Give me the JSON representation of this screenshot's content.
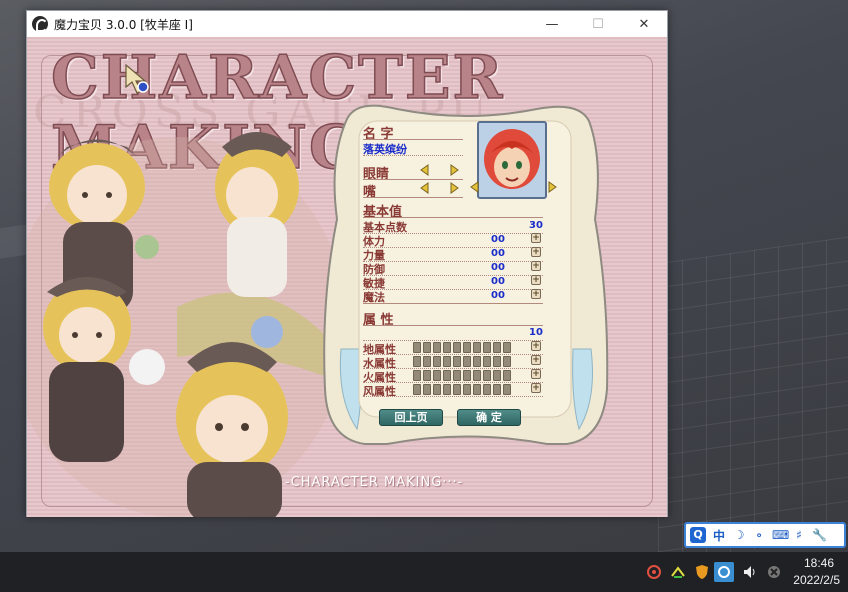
{
  "window": {
    "title": "魔力宝贝 3.0.0 [牧羊座 I]",
    "minimize_glyph": "—",
    "maximize_glyph": "☐",
    "close_glyph": "✕"
  },
  "game": {
    "banner_title": "CHARACTER MAKING",
    "watermark": "CROSS GATE PU",
    "bottom_caption": "-CHARACTER MAKING···-"
  },
  "character": {
    "name_label": "名 字",
    "name_value": "落英缤纷",
    "eyes_label": "眼睛",
    "mouth_label": "嘴",
    "base_stats_label": "基本值",
    "base_points_label": "基本点数",
    "base_points_value": "30",
    "stats": [
      {
        "label": "体力",
        "value": "00"
      },
      {
        "label": "力量",
        "value": "00"
      },
      {
        "label": "防御",
        "value": "00"
      },
      {
        "label": "敏捷",
        "value": "00"
      },
      {
        "label": "魔法",
        "value": "00"
      }
    ],
    "attributes_label": "属 性",
    "attributes_points_value": "10",
    "elements": [
      {
        "label": "地属性"
      },
      {
        "label": "水属性"
      },
      {
        "label": "火属性"
      },
      {
        "label": "风属性"
      }
    ],
    "back_button": "回上页",
    "confirm_button": "确  定"
  },
  "ime": {
    "items": [
      "中",
      "☽",
      "∘",
      "⌨",
      "♯",
      "🔧"
    ],
    "logo": "Q"
  },
  "taskbar": {
    "time": "18:46",
    "date": "2022/2/5"
  },
  "colors": {
    "game_bg": "#e7c9cd",
    "label_red": "#8a3a35",
    "value_blue": "#1a2cc9",
    "button_teal": "#2f6663"
  }
}
